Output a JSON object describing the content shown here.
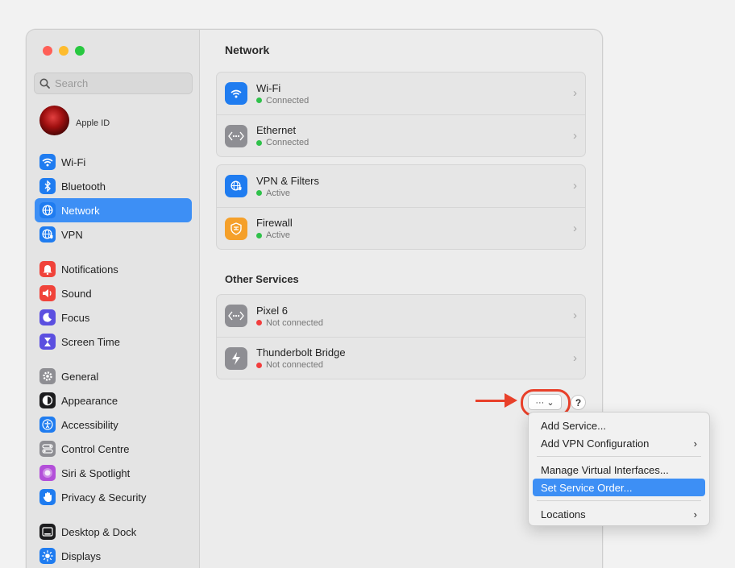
{
  "sidebar": {
    "search_placeholder": "Search",
    "apple_id_label": "Apple ID",
    "groups": [
      [
        {
          "label": "Wi-Fi",
          "icon": "wifi-icon",
          "color": "#1f7cf0"
        },
        {
          "label": "Bluetooth",
          "icon": "bluetooth-icon",
          "color": "#1f7cf0"
        },
        {
          "label": "Network",
          "icon": "globe-icon",
          "color": "#1f7cf0",
          "selected": true
        },
        {
          "label": "VPN",
          "icon": "vpn-globe-icon",
          "color": "#1f7cf0"
        }
      ],
      [
        {
          "label": "Notifications",
          "icon": "bell-icon",
          "color": "#f0433a"
        },
        {
          "label": "Sound",
          "icon": "speaker-icon",
          "color": "#f0433a"
        },
        {
          "label": "Focus",
          "icon": "moon-icon",
          "color": "#5b4fe0"
        },
        {
          "label": "Screen Time",
          "icon": "hourglass-icon",
          "color": "#5b4fe0"
        }
      ],
      [
        {
          "label": "General",
          "icon": "gear-icon",
          "color": "#8e8e93"
        },
        {
          "label": "Appearance",
          "icon": "appearance-icon",
          "color": "#1c1c1e"
        },
        {
          "label": "Accessibility",
          "icon": "accessibility-icon",
          "color": "#1f7cf0"
        },
        {
          "label": "Control Centre",
          "icon": "control-centre-icon",
          "color": "#8e8e93"
        },
        {
          "label": "Siri & Spotlight",
          "icon": "siri-icon",
          "color": "#b34fd9"
        },
        {
          "label": "Privacy & Security",
          "icon": "hand-icon",
          "color": "#1f7cf0"
        }
      ],
      [
        {
          "label": "Desktop & Dock",
          "icon": "dock-icon",
          "color": "#1c1c1e"
        },
        {
          "label": "Displays",
          "icon": "sun-icon",
          "color": "#1f7cf0"
        }
      ]
    ]
  },
  "main": {
    "title": "Network",
    "groups": [
      [
        {
          "name": "Wi-Fi",
          "status": "Connected",
          "state": "green",
          "icon": "wifi-icon",
          "color": "#1f7cf0"
        },
        {
          "name": "Ethernet",
          "status": "Connected",
          "state": "green",
          "icon": "ethernet-icon",
          "color": "#8e8e93"
        }
      ],
      [
        {
          "name": "VPN & Filters",
          "status": "Active",
          "state": "green",
          "icon": "vpn-globe-icon",
          "color": "#1f7cf0"
        },
        {
          "name": "Firewall",
          "status": "Active",
          "state": "green",
          "icon": "firewall-icon",
          "color": "#f5a02a"
        }
      ]
    ],
    "other_services_title": "Other Services",
    "other_services": [
      {
        "name": "Pixel 6",
        "status": "Not connected",
        "state": "red",
        "icon": "ethernet-icon",
        "color": "#8e8e93"
      },
      {
        "name": "Thunderbolt Bridge",
        "status": "Not connected",
        "state": "red",
        "icon": "thunderbolt-icon",
        "color": "#8e8e93"
      }
    ],
    "more_button_label": "··· ⌄",
    "help_label": "?"
  },
  "menu": {
    "items": [
      {
        "label": "Add Service...",
        "submenu": false
      },
      {
        "label": "Add VPN Configuration",
        "submenu": true
      },
      {
        "separator": true
      },
      {
        "label": "Manage Virtual Interfaces...",
        "submenu": false
      },
      {
        "label": "Set Service Order...",
        "submenu": false,
        "selected": true
      },
      {
        "separator": true
      },
      {
        "label": "Locations",
        "submenu": true
      }
    ]
  },
  "colors": {
    "accent": "#3d8ff5",
    "annotation": "#e8402a"
  }
}
